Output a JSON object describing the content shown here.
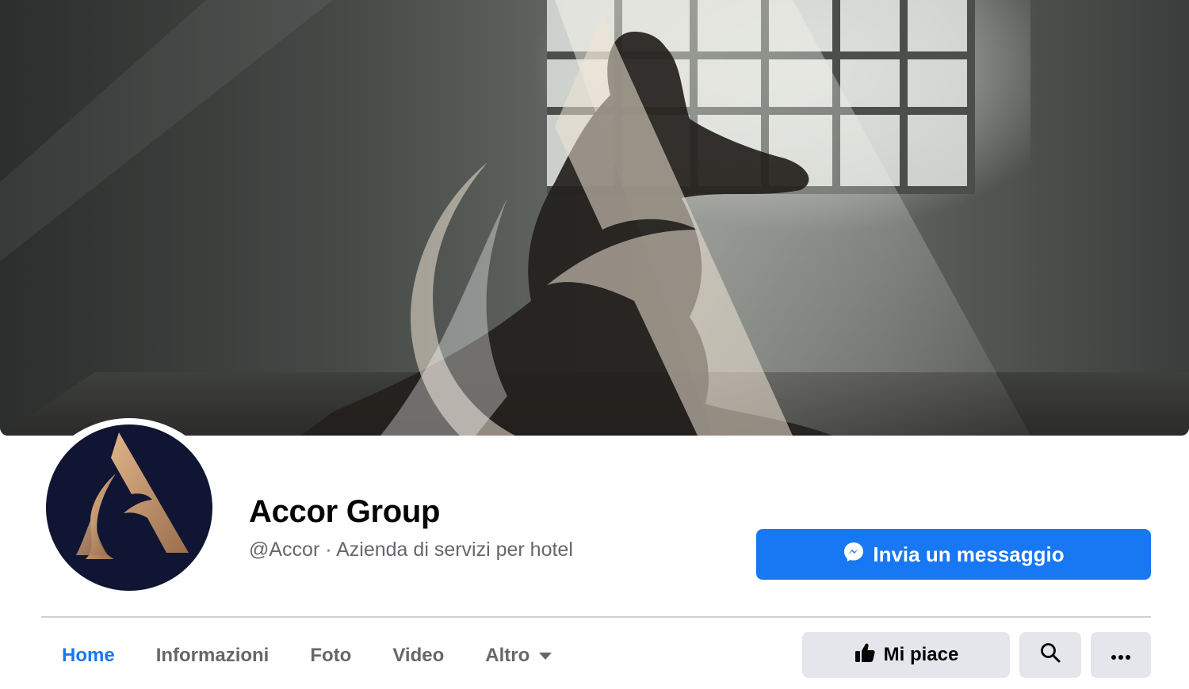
{
  "page": {
    "name": "Accor Group",
    "subtitle": "@Accor · Azienda di servizi per hotel"
  },
  "buttons": {
    "message_label": "Invia un messaggio",
    "like_label": "Mi piace"
  },
  "tabs": [
    {
      "label": "Home",
      "active": true
    },
    {
      "label": "Informazioni",
      "active": false
    },
    {
      "label": "Foto",
      "active": false
    },
    {
      "label": "Video",
      "active": false
    },
    {
      "label": "Altro",
      "active": false,
      "has_dropdown": true
    }
  ],
  "icons": {
    "messenger": "messenger-icon",
    "like": "thumbs-up-icon",
    "search": "search-icon",
    "more": "more-dots-icon",
    "dropdown": "caret-down-icon"
  },
  "colors": {
    "accent": "#1877f2",
    "button_gray": "#e4e6eb",
    "secondary_text": "#65676b",
    "logo_navy": "#111534",
    "logo_gold": "#c8976a"
  }
}
